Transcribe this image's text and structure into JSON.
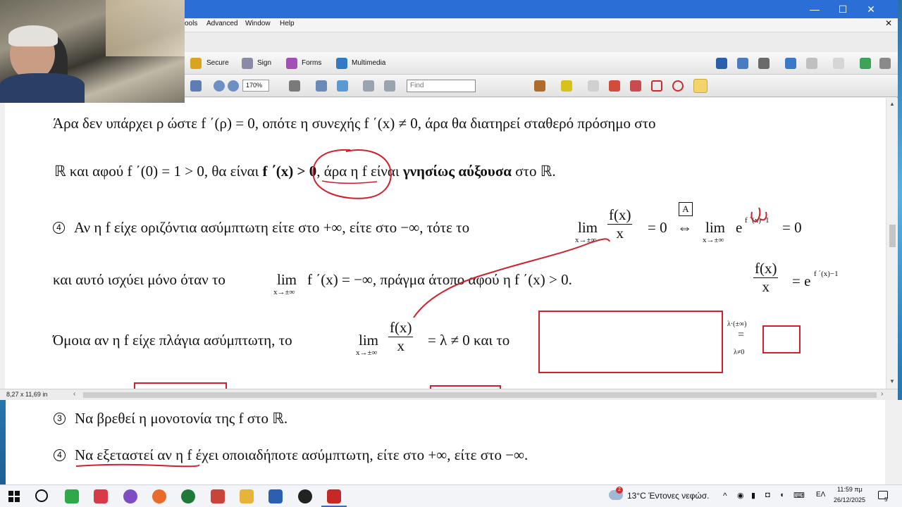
{
  "window": {
    "menu": [
      "ools",
      "Advanced",
      "Window",
      "Help"
    ],
    "controls": [
      "—",
      "☐",
      "✕"
    ]
  },
  "toolbar1": {
    "secure_label": "Secure",
    "sign_label": "Sign",
    "forms_label": "Forms",
    "multimedia_label": "Multimedia"
  },
  "toolbar2": {
    "zoom_value": "170%",
    "find_placeholder": "Find"
  },
  "statusbar": {
    "page_size": "8,27 x 11,69 in"
  },
  "document": {
    "line1": "Άρα δεν υπάρχει ρ ώστε  f ΄(ρ) = 0,  οπότε η συνεχής  f ΄(x) ≠ 0,  άρα θα διατηρεί σταθερό πρόσημο στο",
    "line2_a": "ℝ  και αφού  f ΄(0) = 1 > 0,  θα είναι",
    "line2_b": "f ΄(x) > 0",
    "line2_c": ", άρα η f είναι",
    "line2_d": "γνησίως αύξουσα",
    "line2_e": "στο  ℝ.",
    "line3_num": "4",
    "line3_text": "Αν η f είχε οριζόντια ασύμπτωτη είτε στο  +∞,  είτε στο  −∞,  τότε το",
    "lim": "lim",
    "lim_sub": "x→±∞",
    "frac_num": "f(x)",
    "frac_den": "x",
    "eq_zero": "= 0",
    "iff": "⇔",
    "box_a": "A",
    "exp_base": "e",
    "exp_sup": "f ΄(x)−1",
    "eq_zero2": "= 0",
    "line4_a": "και αυτό ισχύει μόνο όταν το",
    "line4_b": "f ΄(x) = −∞,  πράγμα άτοπο αφού η  f ΄(x) > 0.",
    "side_exp_sup": "f ΄(x)−1",
    "side_eq": "= e",
    "line5_a": "Όμοια αν η f είχε πλάγια ασύμπτωτη, το",
    "line5_b": "= λ ≠ 0  και το",
    "side_note_top": "λ·(±∞)",
    "side_note_eq": "=",
    "side_note_bottom": "λ≠0"
  },
  "lower_page": {
    "item3_num": "3",
    "item3_text": "Να βρεθεί η μονοτονία της f στο  ℝ.",
    "item4_num": "4",
    "item4_underlined": "Να εξεταστεί αν η f",
    "item4_text": " έχει οποιαδήποτε ασύμπτωτη, είτε στο  +∞,  είτε στο  −∞."
  },
  "taskbar": {
    "weather_badge": "2",
    "weather": "13°C  Έντονες νεφώσ.",
    "lang": "ΕΛ",
    "time": "11:59 πμ",
    "date": "26/12/2025",
    "notif_count": "5"
  },
  "colors": {
    "annotation_red": "#d21f2b",
    "title_blue": "#2b6fd6"
  }
}
